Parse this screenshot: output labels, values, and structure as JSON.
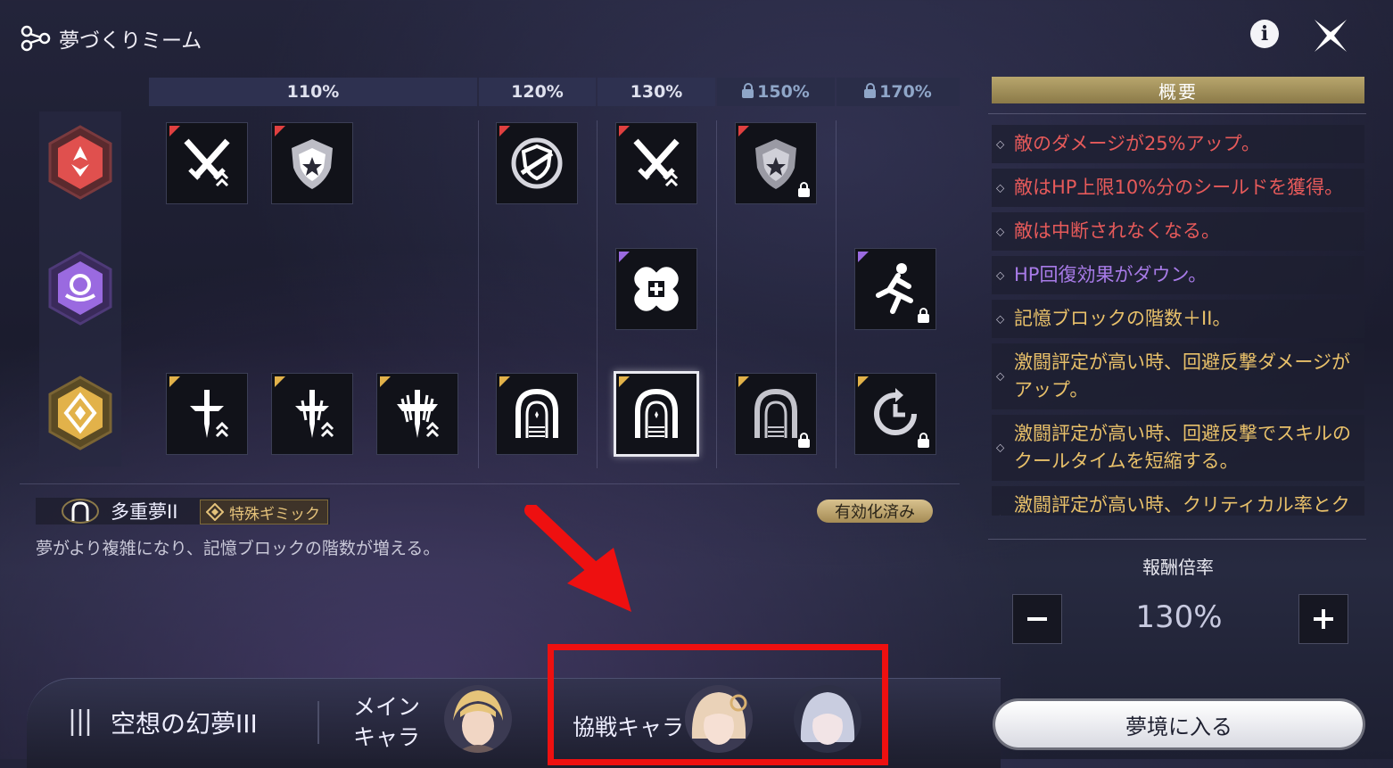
{
  "header": {
    "title": "夢づくりミーム"
  },
  "grid": {
    "columns": [
      {
        "label": "110%",
        "locked": false
      },
      {
        "label": "120%",
        "locked": false
      },
      {
        "label": "130%",
        "locked": false
      },
      {
        "label": "150%",
        "locked": true
      },
      {
        "label": "170%",
        "locked": true
      }
    ]
  },
  "selected": {
    "name": "多重夢II",
    "tag": "特殊ギミック",
    "status": "有効化済み",
    "description": "夢がより複雑になり、記憶ブロックの階数が増える。"
  },
  "summary": {
    "title": "概要",
    "items": [
      {
        "text": "敵のダメージが25%アップ。",
        "color": "#e65a5a"
      },
      {
        "text": "敵はHP上限10%分のシールドを獲得。",
        "color": "#e65a5a"
      },
      {
        "text": "敵は中断されなくなる。",
        "color": "#e65a5a"
      },
      {
        "text": "HP回復効果がダウン。",
        "color": "#a87be8"
      },
      {
        "text": "記憶ブロックの階数＋II。",
        "color": "#e9c16a"
      },
      {
        "text": "激闘評定が高い時、回避反撃ダメージがアップ。",
        "color": "#e9c16a"
      },
      {
        "text": "激闘評定が高い時、回避反撃でスキルのクールタイムを短縮する。",
        "color": "#e9c16a"
      },
      {
        "text": "激闘評定が高い時、クリティカル率とクリティカルダメージがアップ。",
        "color": "#e9c16a"
      }
    ]
  },
  "reward": {
    "label": "報酬倍率",
    "value": "130%"
  },
  "bottom": {
    "dream_name": "空想の幻夢III",
    "main_label_line1": "メイン",
    "main_label_line2": "キャラ",
    "coop_label": "協戦キャラ",
    "enter_label": "夢境に入る"
  },
  "colors": {
    "red": "#e04040",
    "purple": "#9a6ae0",
    "gold": "#e2b24a",
    "annotation": "#ee1010"
  }
}
